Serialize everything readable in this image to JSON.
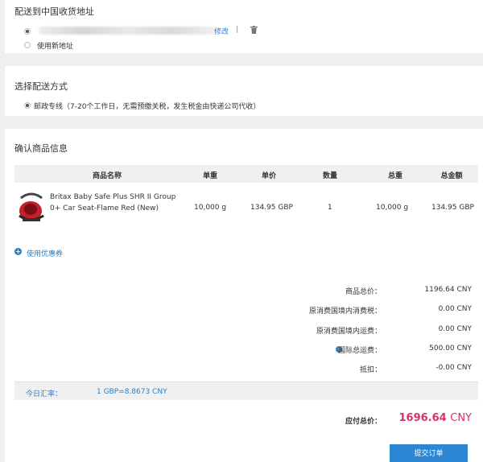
{
  "address": {
    "title": "配送到中国收货地址",
    "edit_label": "修改",
    "separator": "|",
    "new_address_label": "使用新地址"
  },
  "shipping": {
    "title": "选择配送方式",
    "option_label": "邮政专线（7-20个工作日，无需预缴关税，发生税金由快递公司代收）"
  },
  "confirm": {
    "title": "确认商品信息",
    "columns": [
      "商品名称",
      "单重",
      "单价",
      "数量",
      "总重",
      "总金额"
    ],
    "item": {
      "name_line1": "Britax Baby Safe Plus SHR II Group",
      "name_line2": "0+ Car Seat-Flame Red (New)",
      "unit_weight": "10,000 g",
      "unit_price": "134.95 GBP",
      "quantity": "1",
      "total_weight": "10,000 g",
      "total_amount": "134.95 GBP"
    },
    "coupon_label": "使用优惠券"
  },
  "summary": {
    "rows": [
      {
        "label": "商品总价：",
        "value": "1196.64 CNY"
      },
      {
        "label": "原消费国境内消费税：",
        "value": "0.00 CNY"
      },
      {
        "label": "原消费国境内运费：",
        "value": "0.00 CNY"
      },
      {
        "label": "国际总运费：",
        "value": "500.00 CNY"
      },
      {
        "label": "抵扣：",
        "value": "-0.00 CNY"
      }
    ],
    "rate_label": "今日汇率：",
    "rate_value": "1 GBP=8.8673 CNY",
    "total_label": "应付总价：",
    "total_value": "1696.64",
    "total_currency": "CNY",
    "submit_label": "提交订单"
  },
  "colors": {
    "link": "#2a7fc9",
    "total": "#d6316a",
    "button": "#2b87d3"
  }
}
